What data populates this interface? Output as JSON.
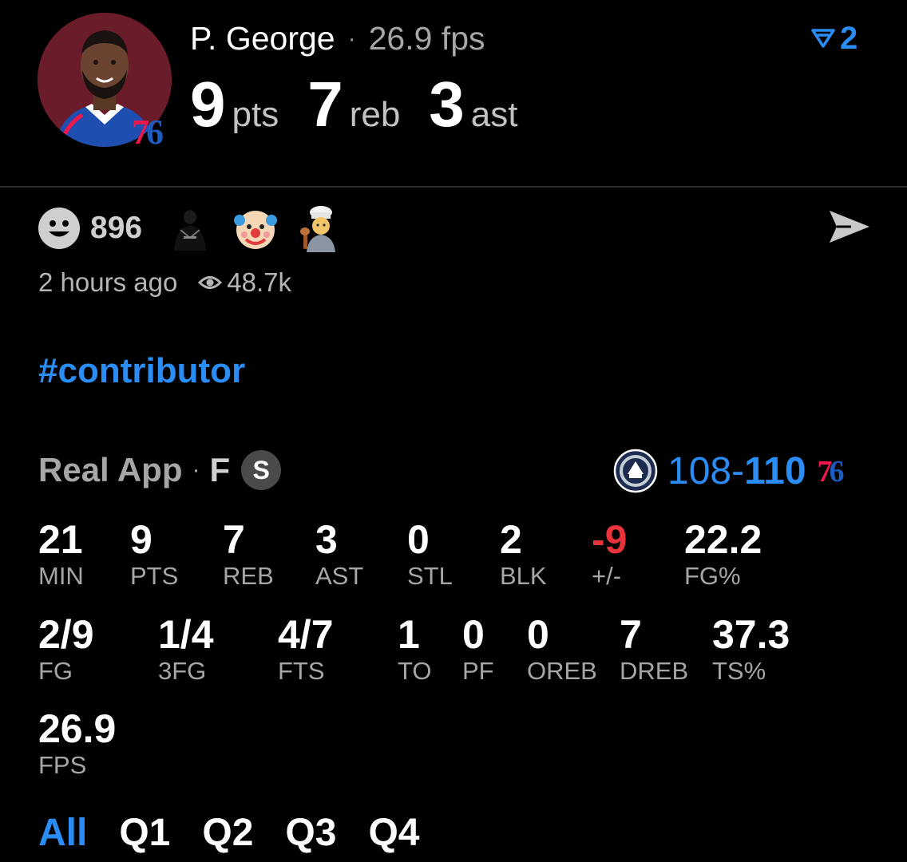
{
  "header": {
    "player_name": "P. George",
    "separator": "·",
    "fps": "26.9 fps",
    "avatar_team_mark_a": "7",
    "avatar_team_mark_b": "6",
    "headline": [
      {
        "value": "9",
        "unit": "pts"
      },
      {
        "value": "7",
        "unit": "reb"
      },
      {
        "value": "3",
        "unit": "ast"
      }
    ],
    "vote_count": "2"
  },
  "reactions": {
    "count": "896",
    "emojis": [
      "player-jersey-emoji",
      "clown-emoji",
      "chef-emoji"
    ]
  },
  "meta": {
    "time_ago": "2 hours ago",
    "views": "48.7k"
  },
  "hashtag": "#contributor",
  "game": {
    "app": "Real App",
    "separator": "·",
    "status": "F",
    "badge": "S",
    "away_score": "108",
    "dash": "-",
    "home_score": "110",
    "home_mark_a": "7",
    "home_mark_b": "6"
  },
  "stats": {
    "row1": [
      {
        "value": "21",
        "label": "MIN"
      },
      {
        "value": "9",
        "label": "PTS"
      },
      {
        "value": "7",
        "label": "REB"
      },
      {
        "value": "3",
        "label": "AST"
      },
      {
        "value": "0",
        "label": "STL"
      },
      {
        "value": "2",
        "label": "BLK"
      },
      {
        "value": "-9",
        "label": "+/-"
      },
      {
        "value": "22.2",
        "label": "FG%"
      }
    ],
    "row2": [
      {
        "value": "2/9",
        "label": "FG"
      },
      {
        "value": "1/4",
        "label": "3FG"
      },
      {
        "value": "4/7",
        "label": "FTS"
      },
      {
        "value": "1",
        "label": "TO"
      },
      {
        "value": "0",
        "label": "PF"
      },
      {
        "value": "0",
        "label": "OREB"
      },
      {
        "value": "7",
        "label": "DREB"
      },
      {
        "value": "37.3",
        "label": "TS%"
      }
    ],
    "row3": [
      {
        "value": "26.9",
        "label": "FPS"
      }
    ]
  },
  "tabs": [
    "All",
    "Q1",
    "Q2",
    "Q3",
    "Q4"
  ],
  "colors": {
    "accent": "#2a8cf5",
    "negative": "#e8333a",
    "muted": "#a6a6a6",
    "background": "#000000"
  }
}
